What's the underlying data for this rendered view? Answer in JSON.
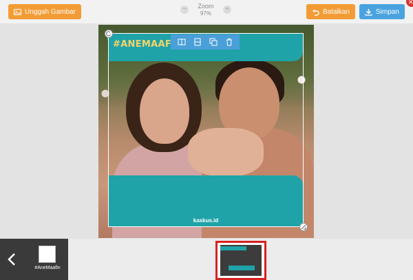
{
  "toolbar": {
    "upload_label": "Unggah Gambar",
    "cancel_label": "Batalkan",
    "save_label": "Simpan"
  },
  "zoom": {
    "label": "Zoom",
    "value": "97%"
  },
  "frame": {
    "hashtag": "#ANEMAAFIN",
    "footer": "kaskus.id"
  },
  "bottom_bar": {
    "frame_thumb_label": "#AneMaafin"
  },
  "colors": {
    "accent_orange": "#f39c35",
    "accent_blue": "#4aa3df",
    "teal": "#1fa3a8",
    "hashtag_gold": "#f3d36b",
    "selection_red": "#d72121"
  },
  "icons": {
    "upload": "image-upload-icon",
    "cancel": "undo-icon",
    "save": "download-icon",
    "tools": [
      "flip-horizontal-icon",
      "flip-vertical-icon",
      "duplicate-icon",
      "trash-icon"
    ]
  }
}
